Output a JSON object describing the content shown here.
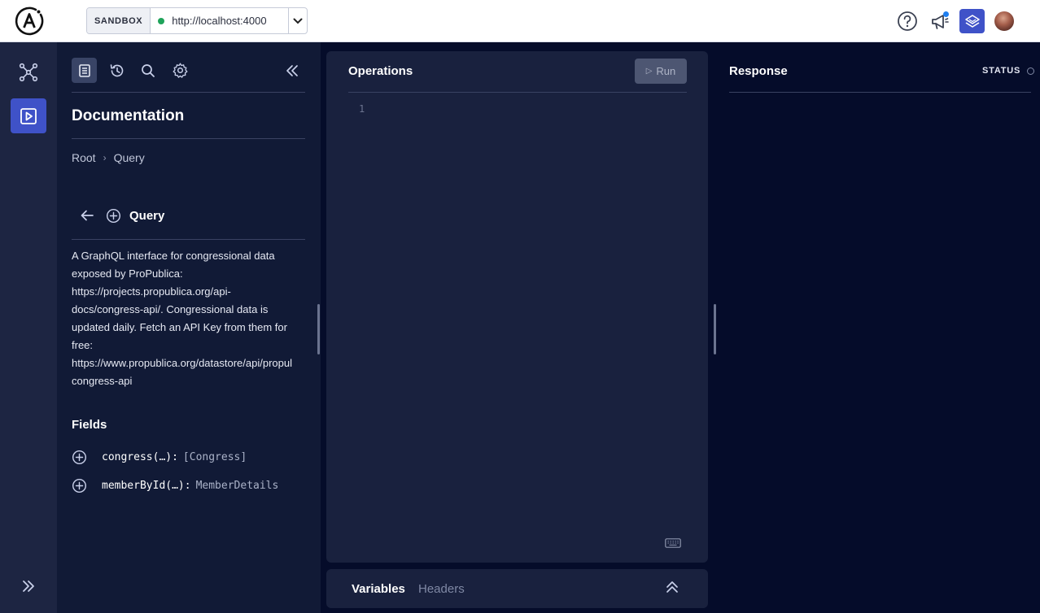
{
  "header": {
    "environment": "SANDBOX",
    "endpoint_url": "http://localhost:4000",
    "icons": [
      "apollo-logo",
      "help-icon",
      "announcements-icon",
      "graph-icon",
      "user-avatar"
    ]
  },
  "rail": {
    "icons": [
      "schema-icon",
      "explorer-icon",
      "expand-icon"
    ]
  },
  "docs": {
    "title": "Documentation",
    "breadcrumb": [
      "Root",
      "Query"
    ],
    "type_name": "Query",
    "description": "A GraphQL interface for congressional data\nexposed by ProPublica:\nhttps://projects.propublica.org/api-\ndocs/congress-api/. Congressional data is\nupdated daily. Fetch an API Key from them for\nfree:\nhttps://www.propublica.org/datastore/api/propul\ncongress-api",
    "fields_title": "Fields",
    "fields": [
      {
        "name": "congress(…):",
        "type": "[Congress]"
      },
      {
        "name": "memberById(…):",
        "type": "MemberDetails"
      }
    ]
  },
  "operations": {
    "title": "Operations",
    "run_label": "Run",
    "line_number": "1"
  },
  "variables": {
    "tab_variables": "Variables",
    "tab_headers": "Headers"
  },
  "response": {
    "title": "Response",
    "status_label": "STATUS"
  },
  "colors": {
    "accent": "#3f52c8",
    "background": "#050c2a",
    "panel": "#19213e",
    "status_ok": "#1fa35a"
  }
}
